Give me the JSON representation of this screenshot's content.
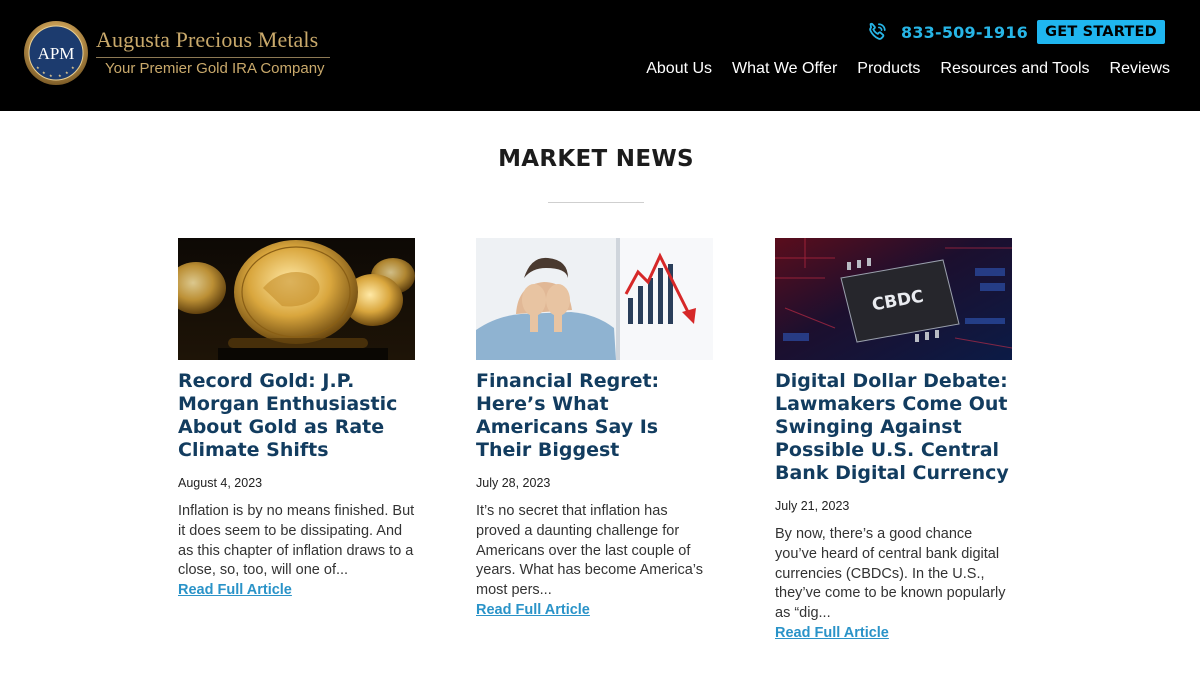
{
  "brand": {
    "logo_initials": "APM",
    "name": "Augusta Precious Metals",
    "tagline": "Your Premier Gold IRA Company"
  },
  "header": {
    "phone": "833-509-1916",
    "phone_icon": "phone-icon",
    "cta_label": "GET STARTED",
    "nav": [
      "About Us",
      "What We Offer",
      "Products",
      "Resources and Tools",
      "Reviews"
    ]
  },
  "section": {
    "title": "MARKET NEWS"
  },
  "articles": [
    {
      "title": "Record Gold: J.P. Morgan Enthusiastic About Gold as Rate Climate Shifts",
      "date": "August 4, 2023",
      "excerpt": "Inflation is by no means finished. But it does seem to be dissipating. And as this chapter of inflation draws to a close, so, too, will one of...",
      "link": "Read Full Article",
      "image": "gold-coins-image"
    },
    {
      "title": "Financial Regret: Here’s What Americans Say Is Their Biggest",
      "date": "July 28, 2023",
      "excerpt": "It’s no secret that inflation has proved a daunting challenge for Americans over the last couple of years. What has become America’s most pers...",
      "link": "Read Full Article",
      "image": "stressed-man-chart-image"
    },
    {
      "title": "Digital Dollar Debate: Lawmakers Come Out Swinging Against Possible U.S. Central Bank Digital Currency",
      "date": "July 21, 2023",
      "excerpt": "By now, there’s a good chance you’ve heard of central bank digital currencies (CBDCs). In the U.S., they’ve come to be known popularly as “dig...",
      "link": "Read Full Article",
      "image": "cbdc-chip-image",
      "image_text": "CBDC"
    }
  ],
  "colors": {
    "header_bg": "#000000",
    "gold": "#c9a96b",
    "accent_blue": "#1fb6f0",
    "title_navy": "#123c5f",
    "link_blue": "#2a93c8"
  }
}
